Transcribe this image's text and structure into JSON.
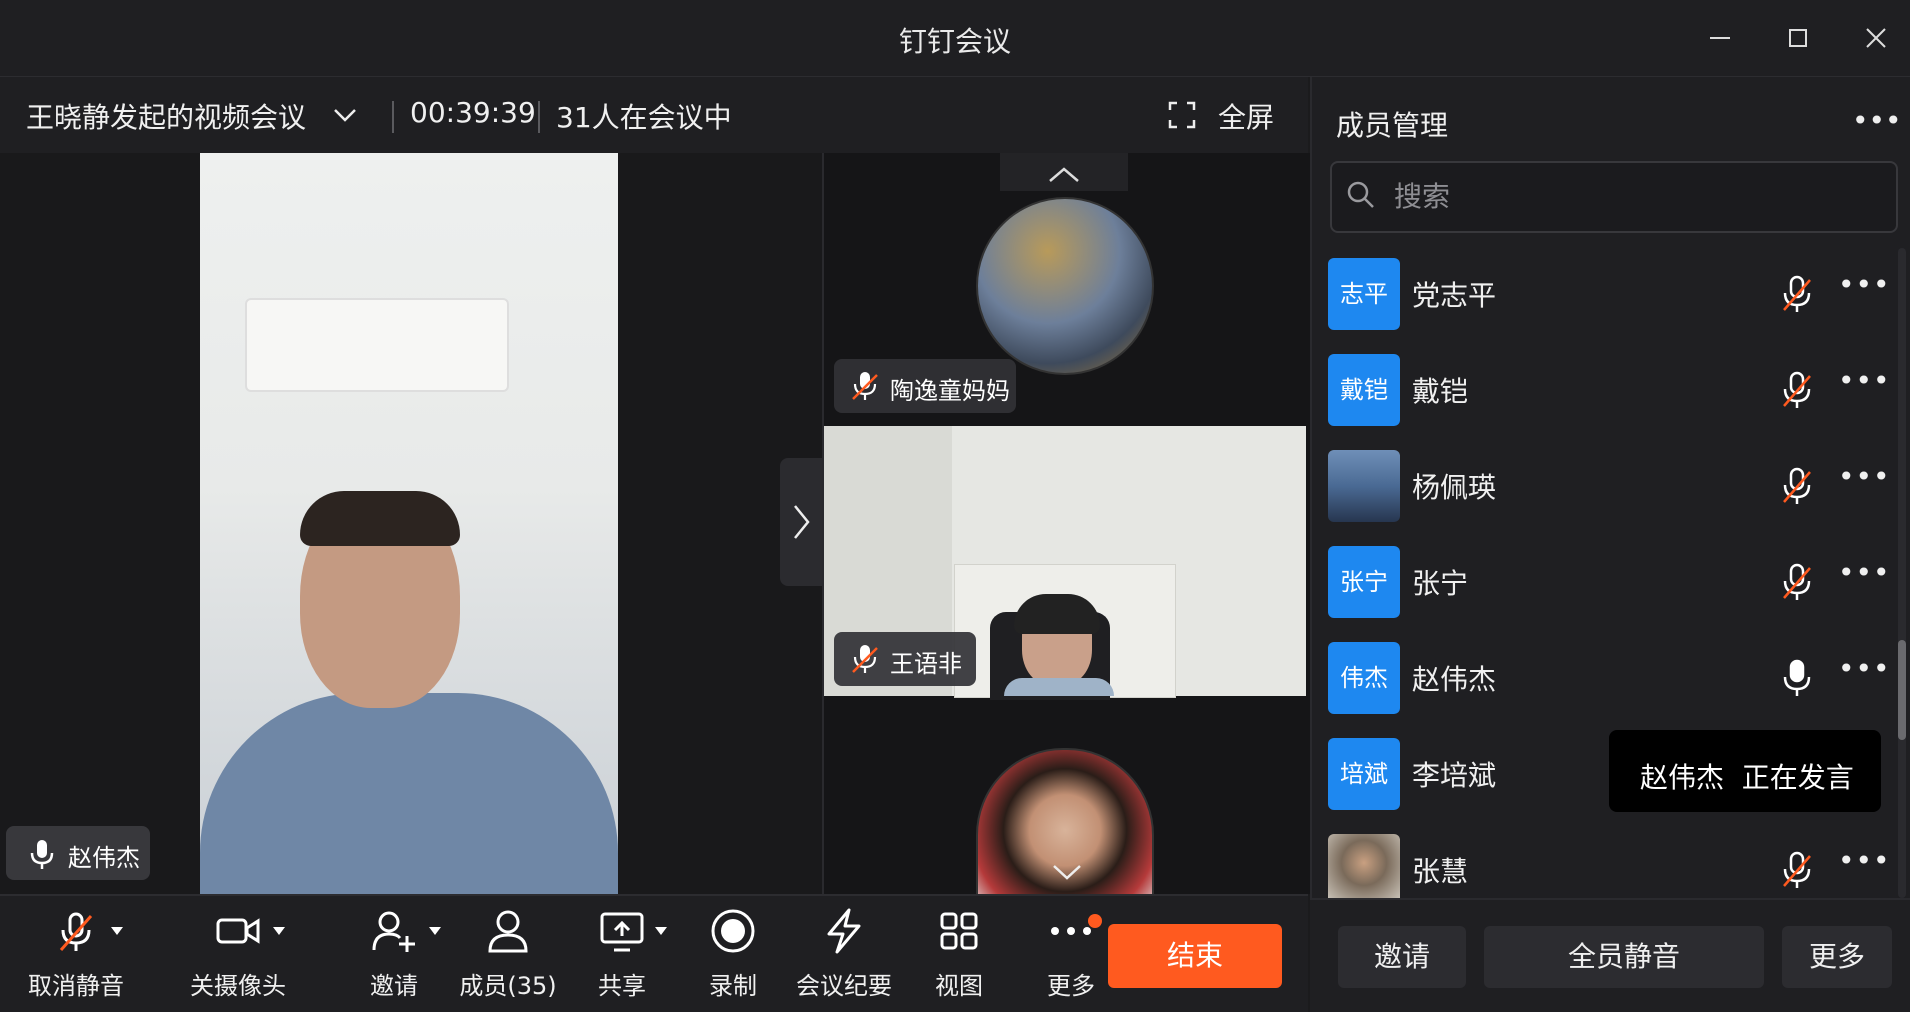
{
  "window": {
    "title": "钉钉会议",
    "controls": {
      "minimize": "—",
      "maximize": "☐",
      "close": "✕"
    }
  },
  "meeting": {
    "name": "王晓静发起的视频会议",
    "time": "00:39:39",
    "count": "31人在会议中",
    "fullscreen_label": "全屏"
  },
  "main_video": {
    "speaker_name": "赵伟杰"
  },
  "thumbnails": [
    {
      "name": "陶逸童妈妈",
      "muted": true
    },
    {
      "name": "王语非",
      "muted": true
    },
    {
      "name": "",
      "muted": true
    }
  ],
  "panel": {
    "title": "成员管理",
    "more": "•••",
    "search_placeholder": "搜索",
    "members": [
      {
        "avatar_text": "志平",
        "name": "党志平",
        "muted": true,
        "more": "•••"
      },
      {
        "avatar_text": "戴铠",
        "name": "戴铠",
        "muted": true,
        "more": "•••"
      },
      {
        "avatar_text": "",
        "name": "杨佩瑛",
        "muted": true,
        "more": "•••"
      },
      {
        "avatar_text": "张宁",
        "name": "张宁",
        "muted": true,
        "more": "•••"
      },
      {
        "avatar_text": "伟杰",
        "name": "赵伟杰",
        "muted": false,
        "more": "•••"
      },
      {
        "avatar_text": "培斌",
        "name": "李培斌",
        "muted": true,
        "more": "•••"
      },
      {
        "avatar_text": "",
        "name": "张慧",
        "muted": true,
        "more": "•••"
      }
    ],
    "tooltip": "赵伟杰  正在发言",
    "footer": {
      "invite": "邀请",
      "mute_all": "全员静音",
      "more": "更多"
    }
  },
  "toolbar": {
    "unmute": "取消静音",
    "camera": "关摄像头",
    "invite": "邀请",
    "members": "成员(35)",
    "share": "共享",
    "record": "录制",
    "minutes": "会议纪要",
    "view": "视图",
    "more": "更多",
    "end": "结束"
  },
  "colors": {
    "accent": "#1e88f0",
    "end": "#ff5a1f",
    "muted_slash": "#ff5a1f"
  }
}
